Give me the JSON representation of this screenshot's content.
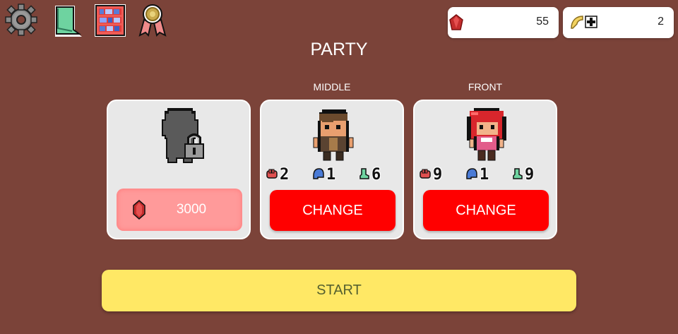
{
  "header": {
    "menu_icons": [
      "gear-icon",
      "book-icon",
      "bookshelf-icon",
      "medal-icon"
    ],
    "gems": {
      "icon": "red-gem-icon",
      "value": "55"
    },
    "boost": {
      "icon": "wing-plus-icon",
      "value": "2"
    }
  },
  "title": "PARTY",
  "slots": [
    {
      "label": "",
      "locked": true,
      "unlock_cost": "3000"
    },
    {
      "label": "MIDDLE",
      "character": "brown-haired-warrior",
      "stats": {
        "attack": "2",
        "defense": "1",
        "speed": "6"
      },
      "button": "CHANGE"
    },
    {
      "label": "FRONT",
      "character": "red-haired-girl",
      "stats": {
        "attack": "9",
        "defense": "1",
        "speed": "9"
      },
      "button": "CHANGE"
    }
  ],
  "start_button": "START",
  "colors": {
    "background": "#7b4339",
    "change_button": "#ff0000",
    "unlock_button": "#ff9a9a",
    "start_button": "#ffe865"
  }
}
